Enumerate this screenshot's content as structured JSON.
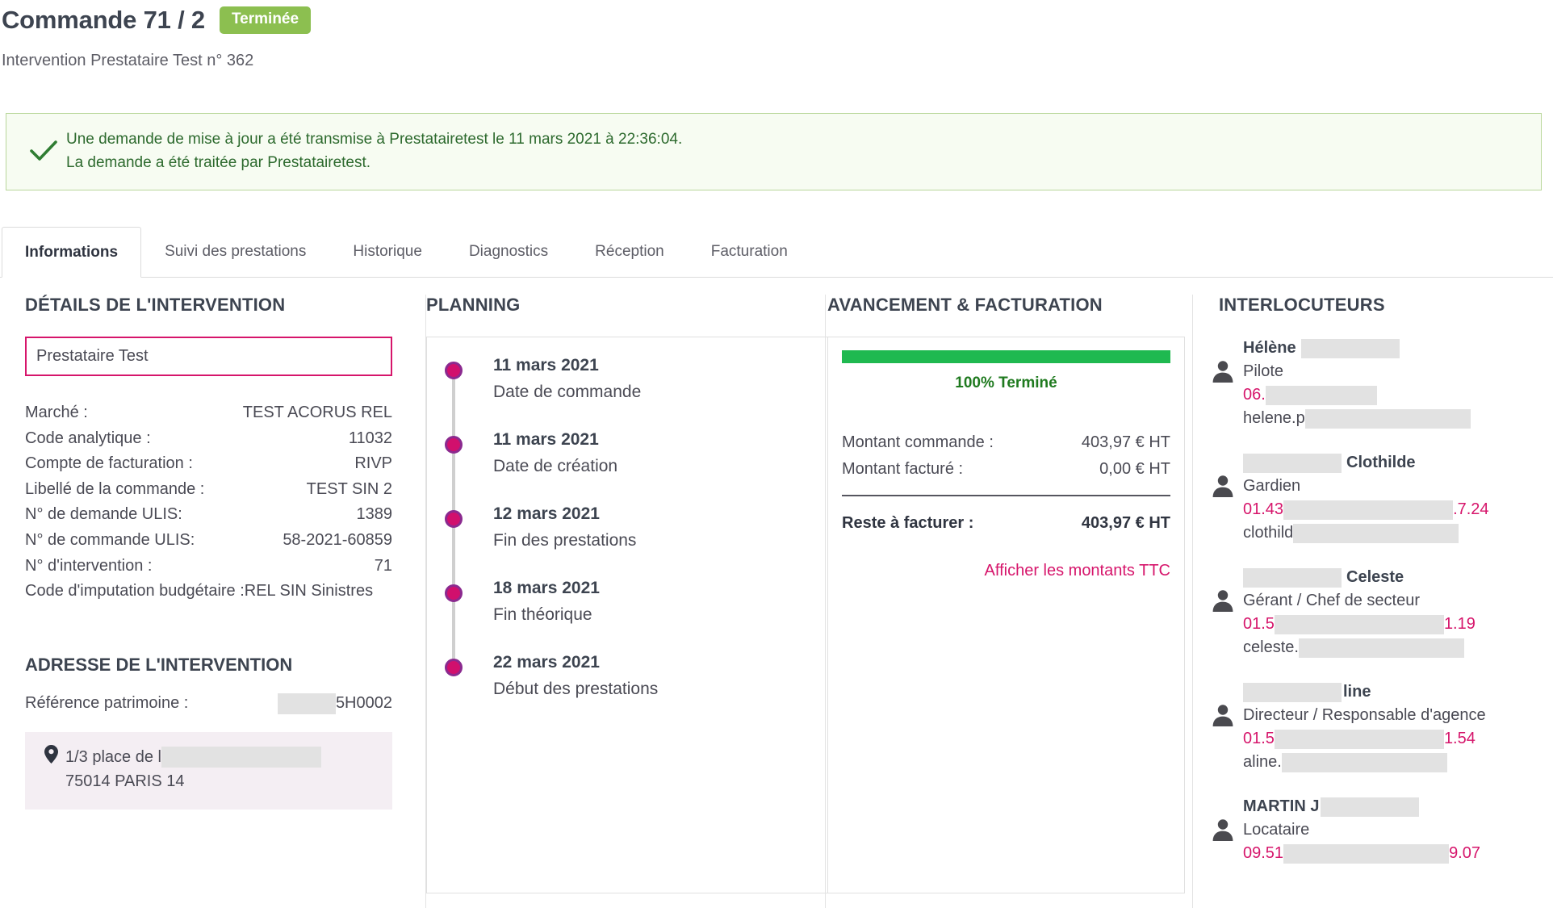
{
  "header": {
    "title": "Commande 71 / 2",
    "status_badge": "Terminée",
    "subtitle": "Intervention Prestataire Test n° 362",
    "badge_color": "#8cbf50"
  },
  "alert": {
    "icon": "check-icon",
    "line1": "Une demande de mise à jour a été transmise à Prestatairetest le 11 mars 2021 à 22:36:04.",
    "line2": "La demande a été traitée par Prestatairetest.",
    "bg_color": "#f7fcf2",
    "border_color": "#b9d79b",
    "text_color": "#2d6a2e"
  },
  "tabs": [
    {
      "label": "Informations",
      "active": true
    },
    {
      "label": "Suivi des prestations",
      "active": false
    },
    {
      "label": "Historique",
      "active": false
    },
    {
      "label": "Diagnostics",
      "active": false
    },
    {
      "label": "Réception",
      "active": false
    },
    {
      "label": "Facturation",
      "active": false
    }
  ],
  "details": {
    "heading": "DÉTAILS DE L'INTERVENTION",
    "vendor_value": "Prestataire Test",
    "vendor_border_color": "#d6156b",
    "rows": [
      {
        "key": "Marché :",
        "value": "TEST ACORUS REL"
      },
      {
        "key": "Code analytique :",
        "value": "11032"
      },
      {
        "key": "Compte de facturation :",
        "value": "RIVP"
      },
      {
        "key": "Libellé de la commande :",
        "value": "TEST SIN 2"
      },
      {
        "key": "N° de demande ULIS:",
        "value": "1389"
      },
      {
        "key": "N° de commande ULIS:",
        "value": "58-2021-60859"
      },
      {
        "key": "N° d'intervention :",
        "value": "71"
      }
    ],
    "budget_line": "Code d'imputation budgétaire :REL SIN Sinistres"
  },
  "address": {
    "heading": "ADRESSE DE L'INTERVENTION",
    "ref_label": "Référence patrimoine :",
    "ref_value_suffix": "5H0002",
    "pin_icon": "map-pin-icon",
    "street": "1/3 place de l",
    "city": "75014 PARIS 14",
    "bg_color": "#f4eef3"
  },
  "planning": {
    "heading": "PLANNING",
    "events": [
      {
        "date": "11 mars 2021",
        "label": "Date de commande"
      },
      {
        "date": "11 mars 2021",
        "label": "Date de création"
      },
      {
        "date": "12 mars 2021",
        "label": "Fin des prestations"
      },
      {
        "date": "18 mars 2021",
        "label": "Fin théorique"
      },
      {
        "date": "22 mars 2021",
        "label": "Début des prestations"
      }
    ],
    "dot_color": "#d1106d"
  },
  "avancement": {
    "heading": "AVANCEMENT & FACTURATION",
    "progress_percent": 100,
    "progress_label": "100% Terminé",
    "progress_color": "#1fb950",
    "rows": [
      {
        "key": "Montant commande :",
        "value": "403,97 € HT"
      },
      {
        "key": "Montant facturé :",
        "value": "0,00 € HT"
      }
    ],
    "total": {
      "key": "Reste à facturer :",
      "value": "403,97 € HT"
    },
    "ttc_link": "Afficher les montants TTC",
    "link_color": "#d6156b"
  },
  "interlocuteurs": {
    "heading": "INTERLOCUTEURS",
    "people": [
      {
        "icon": "person-icon",
        "name_prefix": "Hélène",
        "name_suffix": "",
        "name_redact_width": 122,
        "name_redact_before": false,
        "role": "Pilote",
        "phone_prefix": "06.",
        "phone_suffix": "",
        "phone_redact_width": 138,
        "mail_prefix": "helene.p",
        "mail_redact_width": 205
      },
      {
        "icon": "person-icon",
        "name_prefix": "",
        "name_suffix": "Clothilde",
        "name_redact_width": 122,
        "name_redact_before": true,
        "role": "Gardien",
        "phone_prefix": "01.43",
        "phone_suffix": ".7.24",
        "phone_redact_width": 210,
        "mail_prefix": "clothild",
        "mail_redact_width": 205
      },
      {
        "icon": "person-icon",
        "name_prefix": "",
        "name_suffix": "Celeste",
        "name_redact_width": 122,
        "name_redact_before": true,
        "role": "Gérant / Chef de secteur",
        "phone_prefix": "01.5",
        "phone_suffix": "1.19",
        "phone_redact_width": 210,
        "mail_prefix": "celeste.",
        "mail_redact_width": 205
      },
      {
        "icon": "person-icon",
        "name_prefix": "",
        "name_suffix": "line",
        "name_redact_width": 122,
        "name_redact_before": true,
        "role": "Directeur / Responsable d'agence",
        "phone_prefix": "01.5",
        "phone_suffix": "1.54",
        "phone_redact_width": 210,
        "mail_prefix": "aline.",
        "mail_redact_width": 205
      },
      {
        "icon": "person-icon",
        "name_prefix": "MARTIN J",
        "name_suffix": "",
        "name_redact_width": 122,
        "name_redact_before": false,
        "role": "Locataire",
        "phone_prefix": "09.51",
        "phone_suffix": "9.07",
        "phone_redact_width": 210,
        "mail_prefix": "",
        "mail_redact_width": 0
      }
    ]
  }
}
